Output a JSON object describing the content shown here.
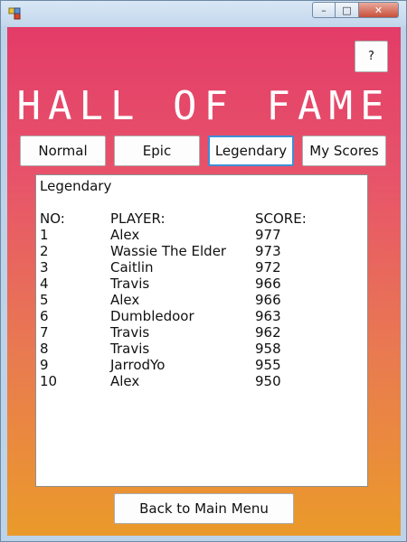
{
  "window": {
    "app_icon": "windows-form-icon",
    "controls": {
      "minimize": "–",
      "maximize": "□",
      "close": "✕"
    }
  },
  "help_button": {
    "label": "?"
  },
  "title": "HALL OF FAME",
  "tabs": [
    {
      "label": "Normal"
    },
    {
      "label": "Epic"
    },
    {
      "label": "Legendary"
    },
    {
      "label": "My Scores"
    }
  ],
  "active_tab": "Legendary",
  "scores": {
    "heading": "Legendary",
    "columns": {
      "no": "NO:",
      "player": "PLAYER:",
      "score": "SCORE:"
    },
    "rows": [
      {
        "no": "1",
        "player": "Alex",
        "score": "977"
      },
      {
        "no": "2",
        "player": "Wassie The Elder",
        "score": "973"
      },
      {
        "no": "3",
        "player": "Caitlin",
        "score": "972"
      },
      {
        "no": "4",
        "player": "Travis",
        "score": "966"
      },
      {
        "no": "5",
        "player": "Alex",
        "score": "966"
      },
      {
        "no": "6",
        "player": "Dumbledoor",
        "score": "963"
      },
      {
        "no": "7",
        "player": "Travis",
        "score": "962"
      },
      {
        "no": "8",
        "player": "Travis",
        "score": "958"
      },
      {
        "no": "9",
        "player": "JarrodYo",
        "score": "955"
      },
      {
        "no": "10",
        "player": "Alex",
        "score": "950"
      }
    ]
  },
  "back_button": {
    "label": "Back to Main Menu"
  }
}
